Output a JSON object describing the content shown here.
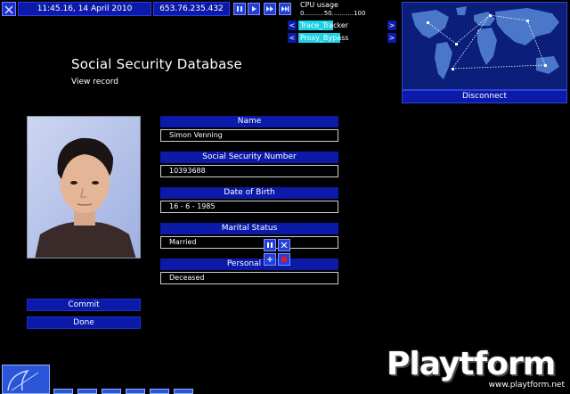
{
  "topbar": {
    "datetime": "11:45.16, 14 April 2010",
    "ip": "653.76.235.432",
    "media_controls": [
      "pause-icon",
      "play-icon",
      "fast-forward-icon",
      "skip-icon"
    ]
  },
  "cpu": {
    "label": "CPU usage",
    "scale": "0..........50...........100"
  },
  "services": [
    {
      "label": "Trace_Tracker",
      "level": 0.48
    },
    {
      "label": "Proxy_Bypass",
      "level": 0.55
    }
  ],
  "map": {
    "disconnect_label": "Disconnect"
  },
  "record": {
    "title": "Social Security Database",
    "subtitle": "View record",
    "fields": [
      {
        "label": "Name",
        "value": "Simon Venning"
      },
      {
        "label": "Social Security Number",
        "value": "10393688"
      },
      {
        "label": "Date of Birth",
        "value": "16 - 6 - 1985"
      },
      {
        "label": "Marital Status",
        "value": "Married"
      },
      {
        "label": "Personal St",
        "value": "Deceased"
      }
    ]
  },
  "actions": {
    "commit": "Commit",
    "done": "Done"
  },
  "watermark": {
    "brand": "Playtform",
    "url": "www.playtform.net"
  },
  "colors": {
    "panel_blue": "#0b1aa8",
    "service_cyan": "#1cd2e6",
    "map_bg": "#071a6e"
  }
}
